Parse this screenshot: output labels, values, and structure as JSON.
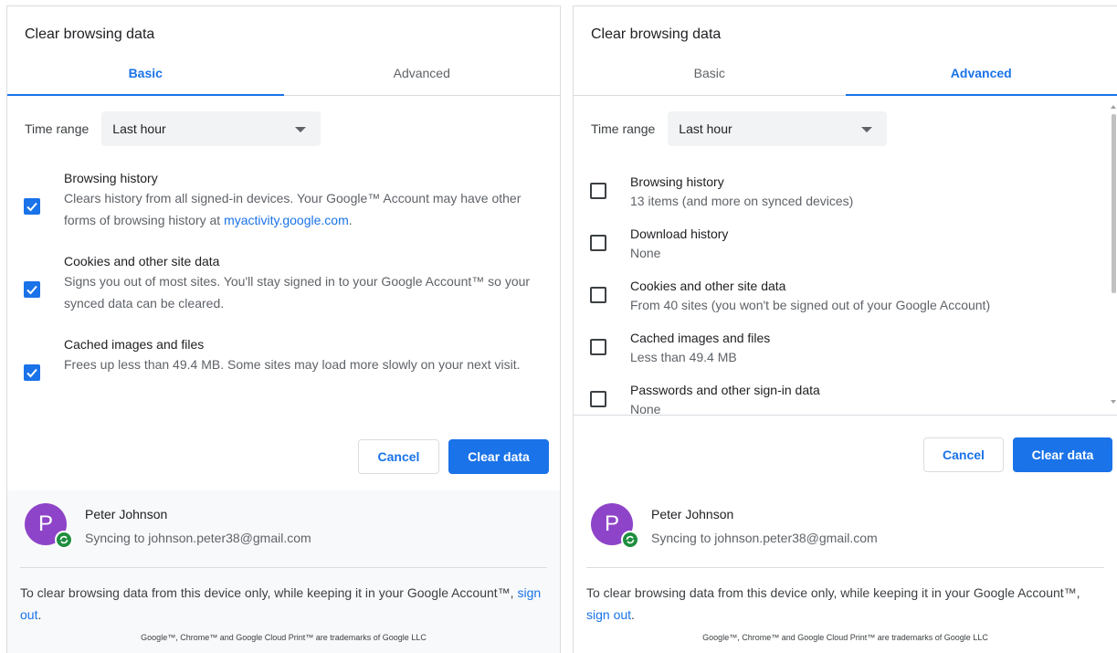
{
  "basic": {
    "title": "Clear browsing data",
    "tabs": [
      {
        "label": "Basic",
        "active": true
      },
      {
        "label": "Advanced",
        "active": false
      }
    ],
    "time_range": {
      "label": "Time range",
      "value": "Last hour"
    },
    "items": [
      {
        "title": "Browsing history",
        "desc_before": "Clears history from all signed-in devices. Your Google™ Account may have other forms of browsing history at ",
        "link": "myactivity.google.com",
        "desc_after": ".",
        "checked": true
      },
      {
        "title": "Cookies and other site data",
        "desc": "Signs you out of most sites. You'll stay signed in to your Google Account™ so your synced data can be cleared.",
        "checked": true
      },
      {
        "title": "Cached images and files",
        "desc": "Frees up less than 49.4 MB. Some sites may load more slowly on your next visit.",
        "checked": true
      }
    ],
    "cancel_label": "Cancel",
    "clear_label": "Clear data",
    "account": {
      "initial": "P",
      "name": "Peter Johnson",
      "email": "Syncing to johnson.peter38@gmail.com"
    },
    "notice_text": "To clear browsing data from this device only, while keeping it in your Google Account™, ",
    "notice_link": "sign out",
    "notice_end": ".",
    "trademark": "Google™, Chrome™ and Google Cloud Print™ are trademarks of Google LLC"
  },
  "advanced": {
    "title": "Clear browsing data",
    "tabs": [
      {
        "label": "Basic",
        "active": false
      },
      {
        "label": "Advanced",
        "active": true
      }
    ],
    "time_range": {
      "label": "Time range",
      "value": "Last hour"
    },
    "items": [
      {
        "title": "Browsing history",
        "desc": "13 items (and more on synced devices)",
        "checked": false
      },
      {
        "title": "Download history",
        "desc": "None",
        "checked": false
      },
      {
        "title": "Cookies and other site data",
        "desc": "From 40 sites (you won't be signed out of your Google Account)",
        "checked": false
      },
      {
        "title": "Cached images and files",
        "desc": "Less than 49.4 MB",
        "checked": false
      },
      {
        "title": "Passwords and other sign-in data",
        "desc": "None",
        "checked": false
      }
    ],
    "cancel_label": "Cancel",
    "clear_label": "Clear data",
    "account": {
      "initial": "P",
      "name": "Peter Johnson",
      "email": "Syncing to johnson.peter38@gmail.com"
    },
    "notice_text": "To clear browsing data from this device only, while keeping it in your Google Account™, ",
    "notice_link": "sign out",
    "notice_end": ".",
    "trademark": "Google™, Chrome™ and Google Cloud Print™ are trademarks of Google LLC"
  },
  "colors": {
    "accent": "#1a73e8",
    "avatar": "#8e44c8",
    "sync_badge": "#1e8e3e"
  },
  "icons": {
    "checkbox_checked": "checkmark-icon",
    "dropdown": "chevron-down-icon",
    "sync": "sync-icon"
  }
}
